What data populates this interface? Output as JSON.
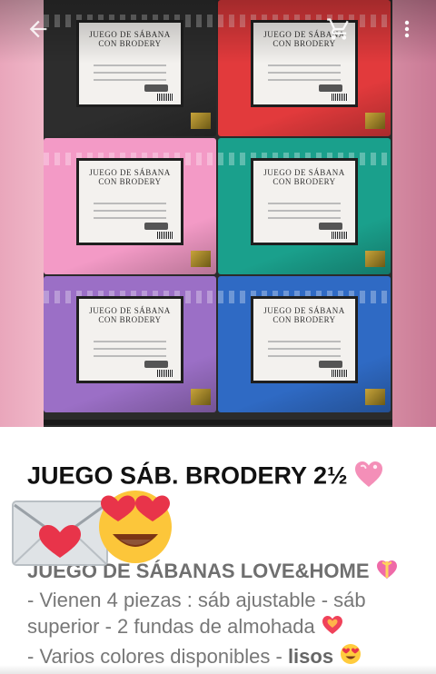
{
  "topbar": {
    "back_icon": "arrow-back-icon",
    "cart_icon": "shopping-cart-icon",
    "more_icon": "more-vert-icon"
  },
  "photo": {
    "packages": [
      {
        "label": "JUEGO DE SÁBANA CON BRODERY",
        "color": "#2d2d2d"
      },
      {
        "label": "JUEGO DE SÁBANA CON BRODERY",
        "color": "#e23a3c"
      },
      {
        "label": "JUEGO DE SÁBANA CON BRODERY",
        "color": "#f39ac6"
      },
      {
        "label": "JUEGO DE SÁBANA CON BRODERY",
        "color": "#1aa08c"
      },
      {
        "label": "JUEGO DE SÁBANA CON BRODERY",
        "color": "#9b6fc6"
      },
      {
        "label": "JUEGO DE SÁBANA CON BRODERY",
        "color": "#2f6ac4"
      }
    ]
  },
  "product": {
    "title": "JUEGO SÁB. BRODERY 2½",
    "description_heading": "JUEGO DE SÁBANAS LOVE&HOME",
    "description_line1": "- Vienen 4 piezas : sáb ajustable - sáb superior - 2 fundas de almohada",
    "description_line2": "- Varios colores disponibles - ",
    "description_bold": "lisos"
  },
  "overlay": {
    "envelope_icon": "love-letter-icon",
    "face_icon": "heart-eyes-face-icon"
  }
}
